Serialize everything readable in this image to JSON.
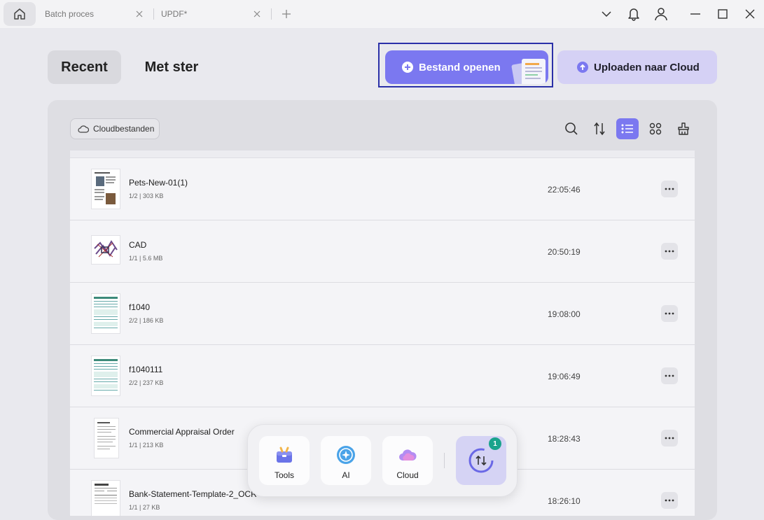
{
  "titlebar": {
    "tabs": [
      {
        "label": "Batch proces"
      },
      {
        "label": "UPDF*"
      }
    ]
  },
  "nav": {
    "recent": "Recent",
    "starred": "Met ster"
  },
  "actions": {
    "open_file": "Bestand openen",
    "upload_cloud": "Uploaden naar Cloud"
  },
  "toolbar": {
    "cloud_files": "Cloudbestanden"
  },
  "files": [
    {
      "name": "Pets-New-01(1)",
      "meta": "1/2 | 303 KB",
      "time": "22:05:46"
    },
    {
      "name": "CAD",
      "meta": "1/1 | 5.6 MB",
      "time": "20:50:19"
    },
    {
      "name": "f1040",
      "meta": "2/2 | 186 KB",
      "time": "19:08:00"
    },
    {
      "name": "f1040111",
      "meta": "2/2 | 237 KB",
      "time": "19:06:49"
    },
    {
      "name": "Commercial Appraisal Order",
      "meta": "1/1 | 213 KB",
      "time": "18:28:43"
    },
    {
      "name": "Bank-Statement-Template-2_OCR",
      "meta": "1/1 | 27 KB",
      "time": "18:26:10"
    }
  ],
  "dock": {
    "tools": "Tools",
    "ai": "AI",
    "cloud": "Cloud",
    "sync_badge": "1"
  },
  "colors": {
    "accent": "#7b78f0",
    "accent_soft": "#d5d1f5",
    "badge": "#1aa38c"
  }
}
